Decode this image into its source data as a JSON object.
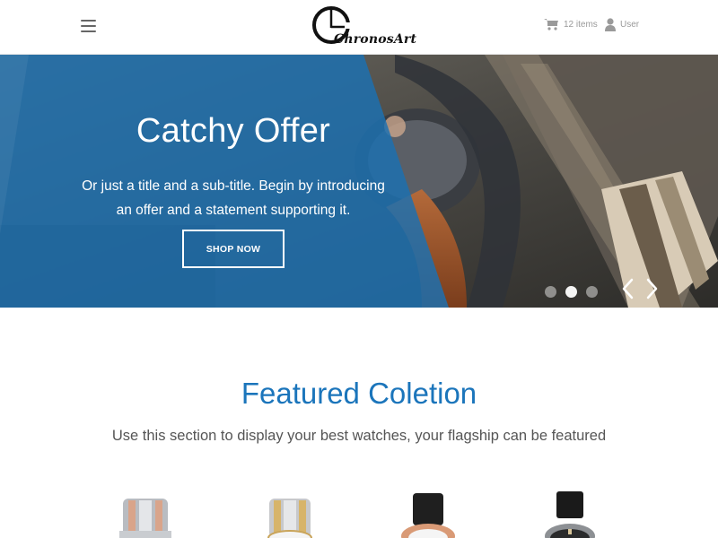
{
  "header": {
    "menu_icon": "hamburger-menu-icon",
    "logo_text": "ChronosArt",
    "cart_icon": "shopping-cart-icon",
    "cart_label": "12 items",
    "user_icon": "user-icon",
    "user_label": "User"
  },
  "hero": {
    "title": "Catchy Offer",
    "subtitle_line1": "Or just a title and a sub-title. Begin by introducing",
    "subtitle_line2": "an offer and a statement supporting it.",
    "button_label": "SHOP NOW",
    "slides": 3,
    "active_slide": 2,
    "prev_icon": "chevron-left-icon",
    "next_icon": "chevron-right-icon"
  },
  "featured": {
    "title": "Featured Coletion",
    "subtitle": "Use this section to display your best watches, your flagship can be featured"
  },
  "colors": {
    "accent": "#1b75bb",
    "panel": "#1d70b0",
    "header_text": "#9a9a9a"
  }
}
